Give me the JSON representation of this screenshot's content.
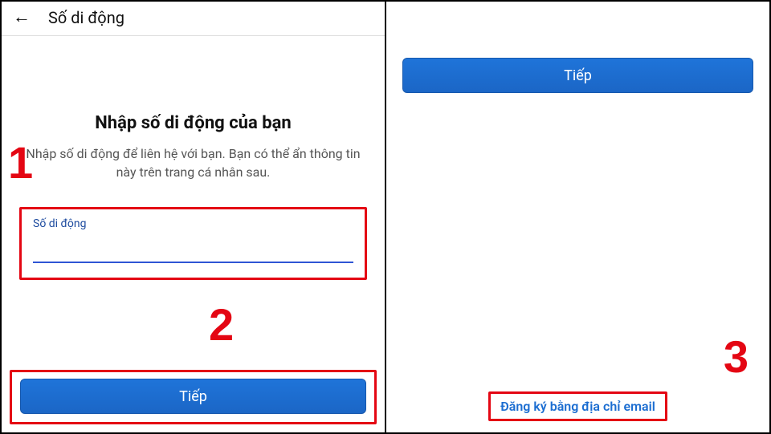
{
  "left": {
    "header_title": "Số di động",
    "main_title": "Nhập số di động của bạn",
    "subtitle": "Nhập số di động để liên hệ với bạn. Bạn có thể ẩn thông tin này trên trang cá nhân sau.",
    "input_label": "Số di động",
    "input_value": "",
    "next_button": "Tiếp"
  },
  "right": {
    "next_button": "Tiếp",
    "email_link": "Đăng ký bằng địa chỉ email"
  },
  "callouts": {
    "one": "1",
    "two": "2",
    "three": "3"
  }
}
